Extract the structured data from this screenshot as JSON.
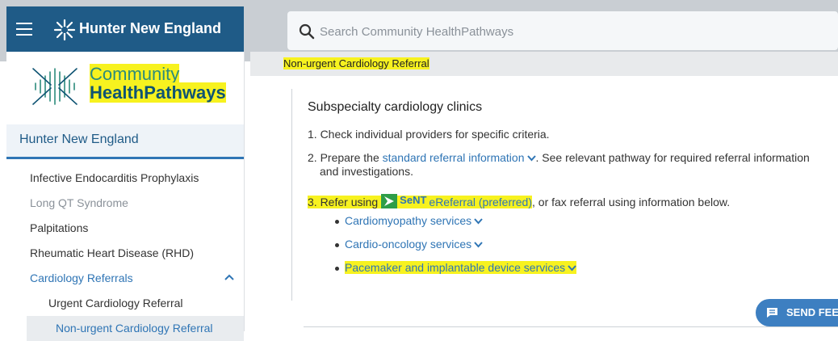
{
  "header": {
    "brand": "Hunter New England",
    "search": {
      "placeholder": "Search Community HealthPathways"
    }
  },
  "sidebar": {
    "logo": {
      "line1": "Community",
      "line2": "HealthPathways"
    },
    "region": "Hunter New England",
    "items": [
      {
        "label": "Infective Endocarditis Prophylaxis"
      },
      {
        "label": "Long QT Syndrome"
      },
      {
        "label": "Palpitations"
      },
      {
        "label": "Rheumatic Heart Disease (RHD)"
      },
      {
        "label": "Cardiology Referrals"
      },
      {
        "label": "Urgent Cardiology Referral"
      },
      {
        "label": "Non-urgent Cardiology Referral"
      }
    ]
  },
  "content": {
    "breadcrumb": "Non-urgent Cardiology Referral",
    "section_title": "Subspecialty cardiology clinics",
    "steps": {
      "s1": "1. Check individual providers for specific criteria.",
      "s2_prefix": "2. Prepare the",
      "s2_link": "standard referral information",
      "s2_suffix": ". See relevant pathway for required referral information",
      "s2_line2": "and investigations.",
      "s3_prefix": "3. Refer using",
      "s3_sent": "SeNT",
      "s3_link": "eReferral (preferred)",
      "s3_suffix": ", or fax referral using information below."
    },
    "services": [
      {
        "label": "Cardiomyopathy services"
      },
      {
        "label": "Cardio-oncology services"
      },
      {
        "label": "Pacemaker and implantable device services"
      }
    ]
  },
  "feedback": {
    "label": "SEND FEE"
  },
  "colors": {
    "header_blue": "#1f5b87",
    "link_blue": "#2f75b5",
    "highlight": "#f7f21f",
    "sent_green": "#2e9d48"
  }
}
